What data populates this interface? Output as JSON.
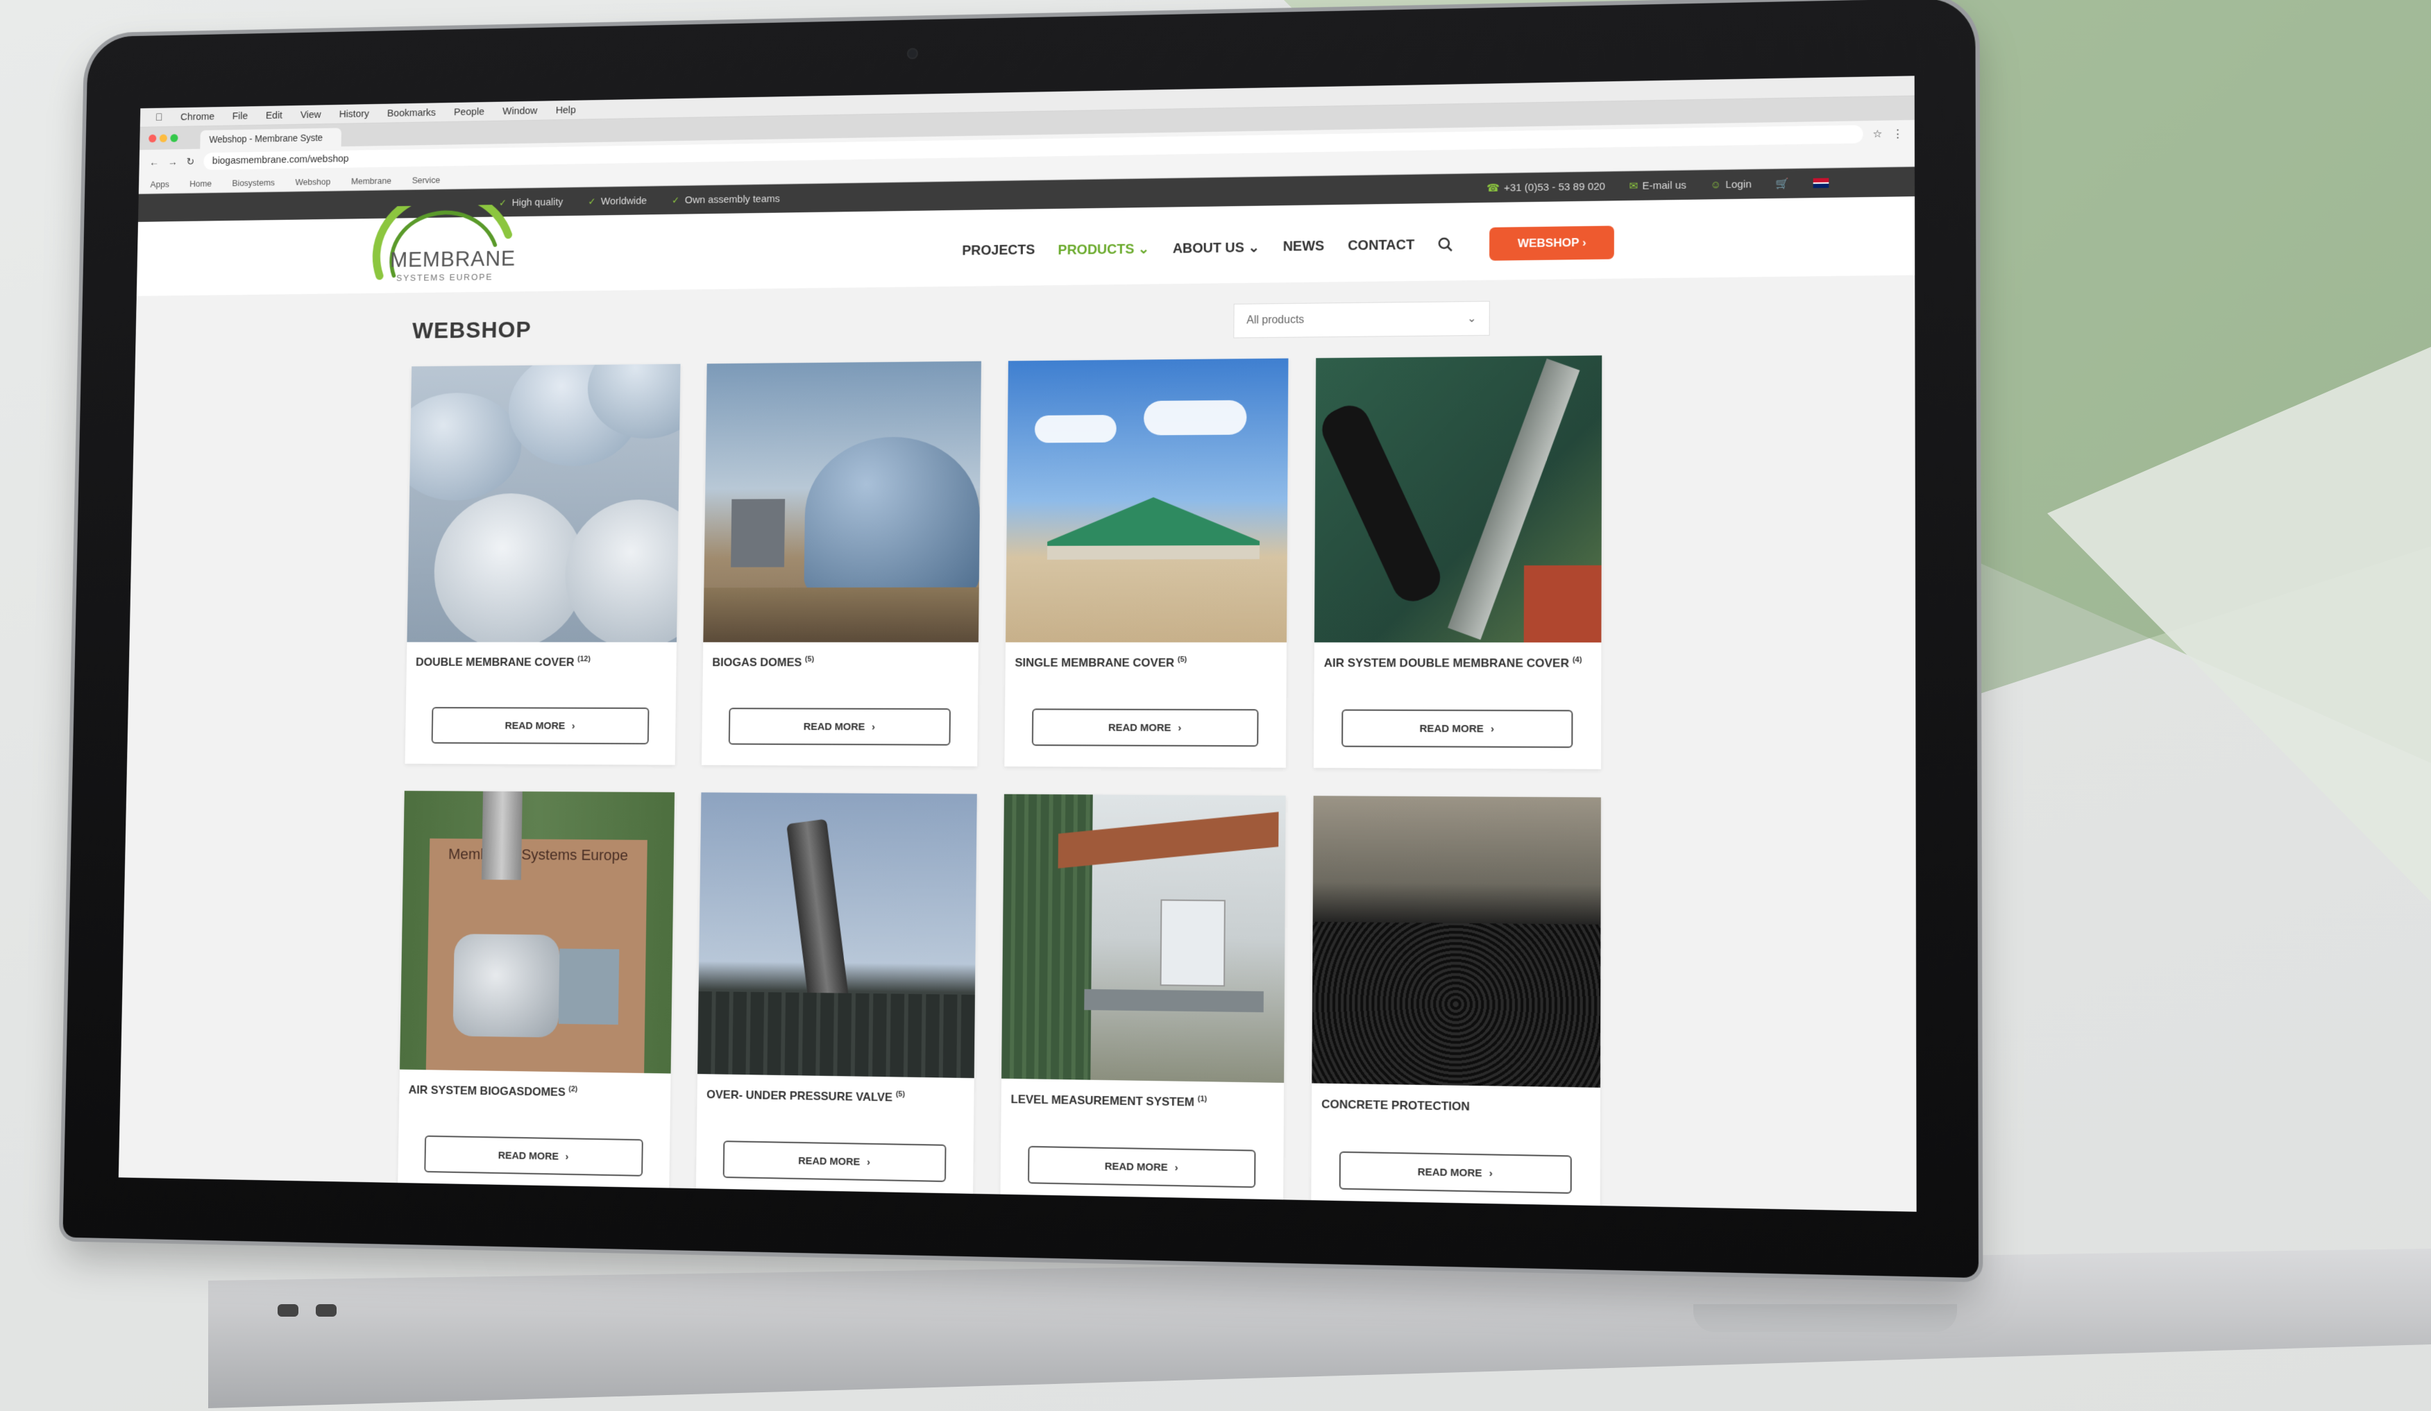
{
  "browser": {
    "menubar": [
      "Chrome",
      "File",
      "Edit",
      "View",
      "History",
      "Bookmarks",
      "People",
      "Window",
      "Help"
    ],
    "tab_title": "Webshop - Membrane Syste",
    "url": "biogasmembrane.com/webshop",
    "bookmarks": [
      "Apps",
      "Home",
      "Biosystems",
      "Webshop",
      "Membrane",
      "Service"
    ]
  },
  "topbar": {
    "usps": [
      "High quality",
      "Worldwide",
      "Own assembly teams"
    ],
    "phone": "+31 (0)53 - 53 89 020",
    "email": "E-mail us",
    "login": "Login"
  },
  "logo": {
    "name": "MEMBRANE",
    "sub": "SYSTEMS EUROPE"
  },
  "nav": {
    "projects": "PROJECTS",
    "products": "PRODUCTS",
    "about": "ABOUT US",
    "news": "NEWS",
    "contact": "CONTACT",
    "webshop": "WEBSHOP"
  },
  "page": {
    "title": "WEBSHOP",
    "filter": "All products"
  },
  "products": [
    {
      "title": "DOUBLE MEMBRANE COVER",
      "count": "(12)",
      "button": "READ MORE"
    },
    {
      "title": "BIOGAS DOMES",
      "count": "(5)",
      "button": "READ MORE"
    },
    {
      "title": "SINGLE MEMBRANE COVER",
      "count": "(5)",
      "button": "READ MORE"
    },
    {
      "title": "AIR SYSTEM DOUBLE MEMBRANE COVER",
      "count": "(4)",
      "button": "READ MORE"
    },
    {
      "title": "AIR SYSTEM BIOGASDOMES",
      "count": "(2)",
      "button": "READ MORE"
    },
    {
      "title": "OVER- UNDER PRESSURE VALVE",
      "count": "(5)",
      "button": "READ MORE"
    },
    {
      "title": "LEVEL MEASUREMENT SYSTEM",
      "count": "(1)",
      "button": "READ MORE"
    },
    {
      "title": "CONCRETE PROTECTION",
      "count": "",
      "button": "READ MORE"
    }
  ],
  "image_signage": "Membrane Systems Europe",
  "colors": {
    "accent_green": "#6aaa2c",
    "webshop_orange": "#ee5a2f",
    "topbar": "#3c3c3c"
  }
}
